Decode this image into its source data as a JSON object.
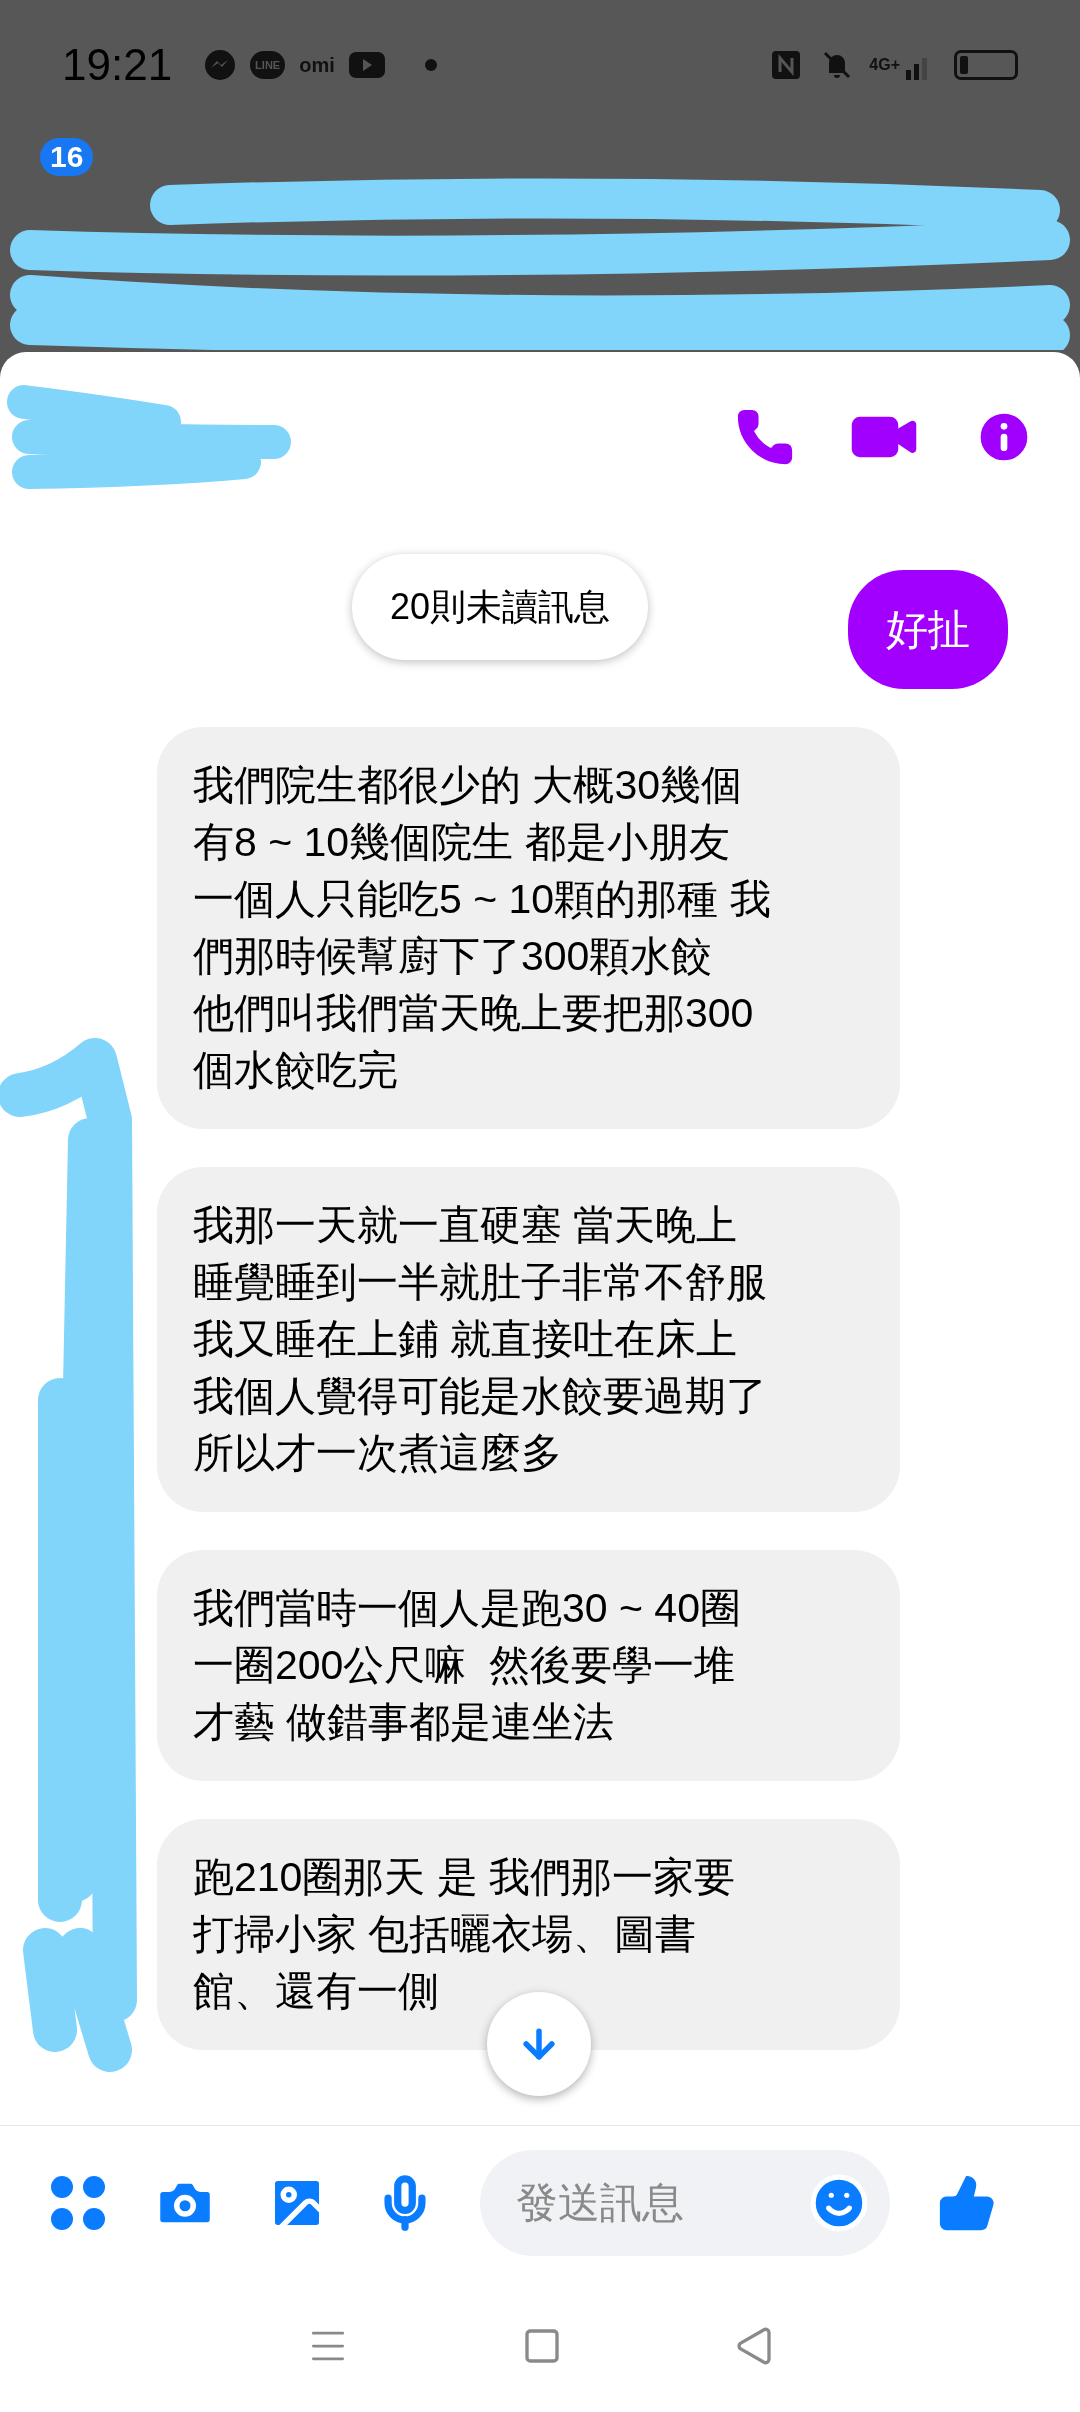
{
  "status_bar": {
    "time": "19:21",
    "line_label": "LINE",
    "omi_label": "omi",
    "network": "4G+"
  },
  "chat_heads": {
    "badge": "16"
  },
  "unread_banner": "20則未讀訊息",
  "messages": [
    {
      "kind": "sent",
      "lines": [
        "好扯"
      ]
    },
    {
      "kind": "received",
      "lines": [
        "我們院生都很少的 大概30幾個",
        "有8 ~ 10幾個院生 都是小朋友",
        "一個人只能吃5 ~ 10顆的那種 我",
        "們那時候幫廚下了300顆水餃",
        "他們叫我們當天晚上要把那300",
        "個水餃吃完"
      ]
    },
    {
      "kind": "received",
      "lines": [
        "我那一天就一直硬塞 當天晚上",
        "睡覺睡到一半就肚子非常不舒服",
        "我又睡在上鋪 就直接吐在床上",
        "我個人覺得可能是水餃要過期了",
        "所以才一次煮這麼多"
      ]
    },
    {
      "kind": "received",
      "lines": [
        "我們當時一個人是跑30 ~ 40圈",
        "一圈200公尺嘛  然後要學一堆",
        "才藝 做錯事都是連坐法"
      ]
    },
    {
      "kind": "received",
      "lines": [
        "跑210圈那天 是 我們那一家要",
        "打掃小家 包括曬衣場、圖書",
        "館、還有一側"
      ]
    }
  ],
  "composer": {
    "placeholder": "發送訊息"
  }
}
